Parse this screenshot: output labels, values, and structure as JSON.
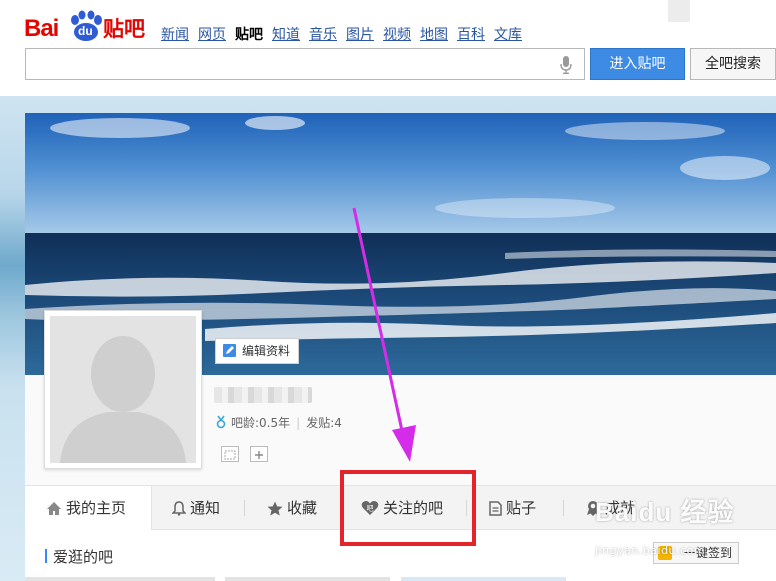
{
  "logo": {
    "text_bai": "Bai",
    "text_du": "du",
    "text_tieba": "贴吧"
  },
  "topnav": [
    "新闻",
    "网页",
    "贴吧",
    "知道",
    "音乐",
    "图片",
    "视频",
    "地图",
    "百科",
    "文库"
  ],
  "topnav_active": "贴吧",
  "search": {
    "value": "",
    "placeholder": "",
    "enter_label": "进入贴吧",
    "all_label": "全吧搜索"
  },
  "profile": {
    "edit_label": "编辑资料",
    "bar_age_label": "吧龄:0.5年",
    "posts_label": "发贴:4",
    "separator": "|"
  },
  "tabs": [
    {
      "label": "我的主页",
      "icon": "home-icon",
      "active": true
    },
    {
      "label": "通知",
      "icon": "bell-icon",
      "active": false
    },
    {
      "label": "收藏",
      "icon": "star-icon",
      "active": false
    },
    {
      "label": "关注的吧",
      "icon": "heart-ba-icon",
      "active": false
    },
    {
      "label": "贴子",
      "icon": "document-icon",
      "active": false
    },
    {
      "label": "成就",
      "icon": "award-icon",
      "active": false
    }
  ],
  "content": {
    "section_title": "爱逛的吧",
    "sign_label": "一键签到"
  },
  "watermark": {
    "main": "Baidu 经验",
    "sub": "jingyan.baidu.com"
  },
  "colors": {
    "brand_red": "#e10602",
    "link_blue": "#2a56a4",
    "button_blue": "#3d8be4",
    "highlight_red": "#e3242b",
    "arrow_magenta": "#d42ce8"
  }
}
